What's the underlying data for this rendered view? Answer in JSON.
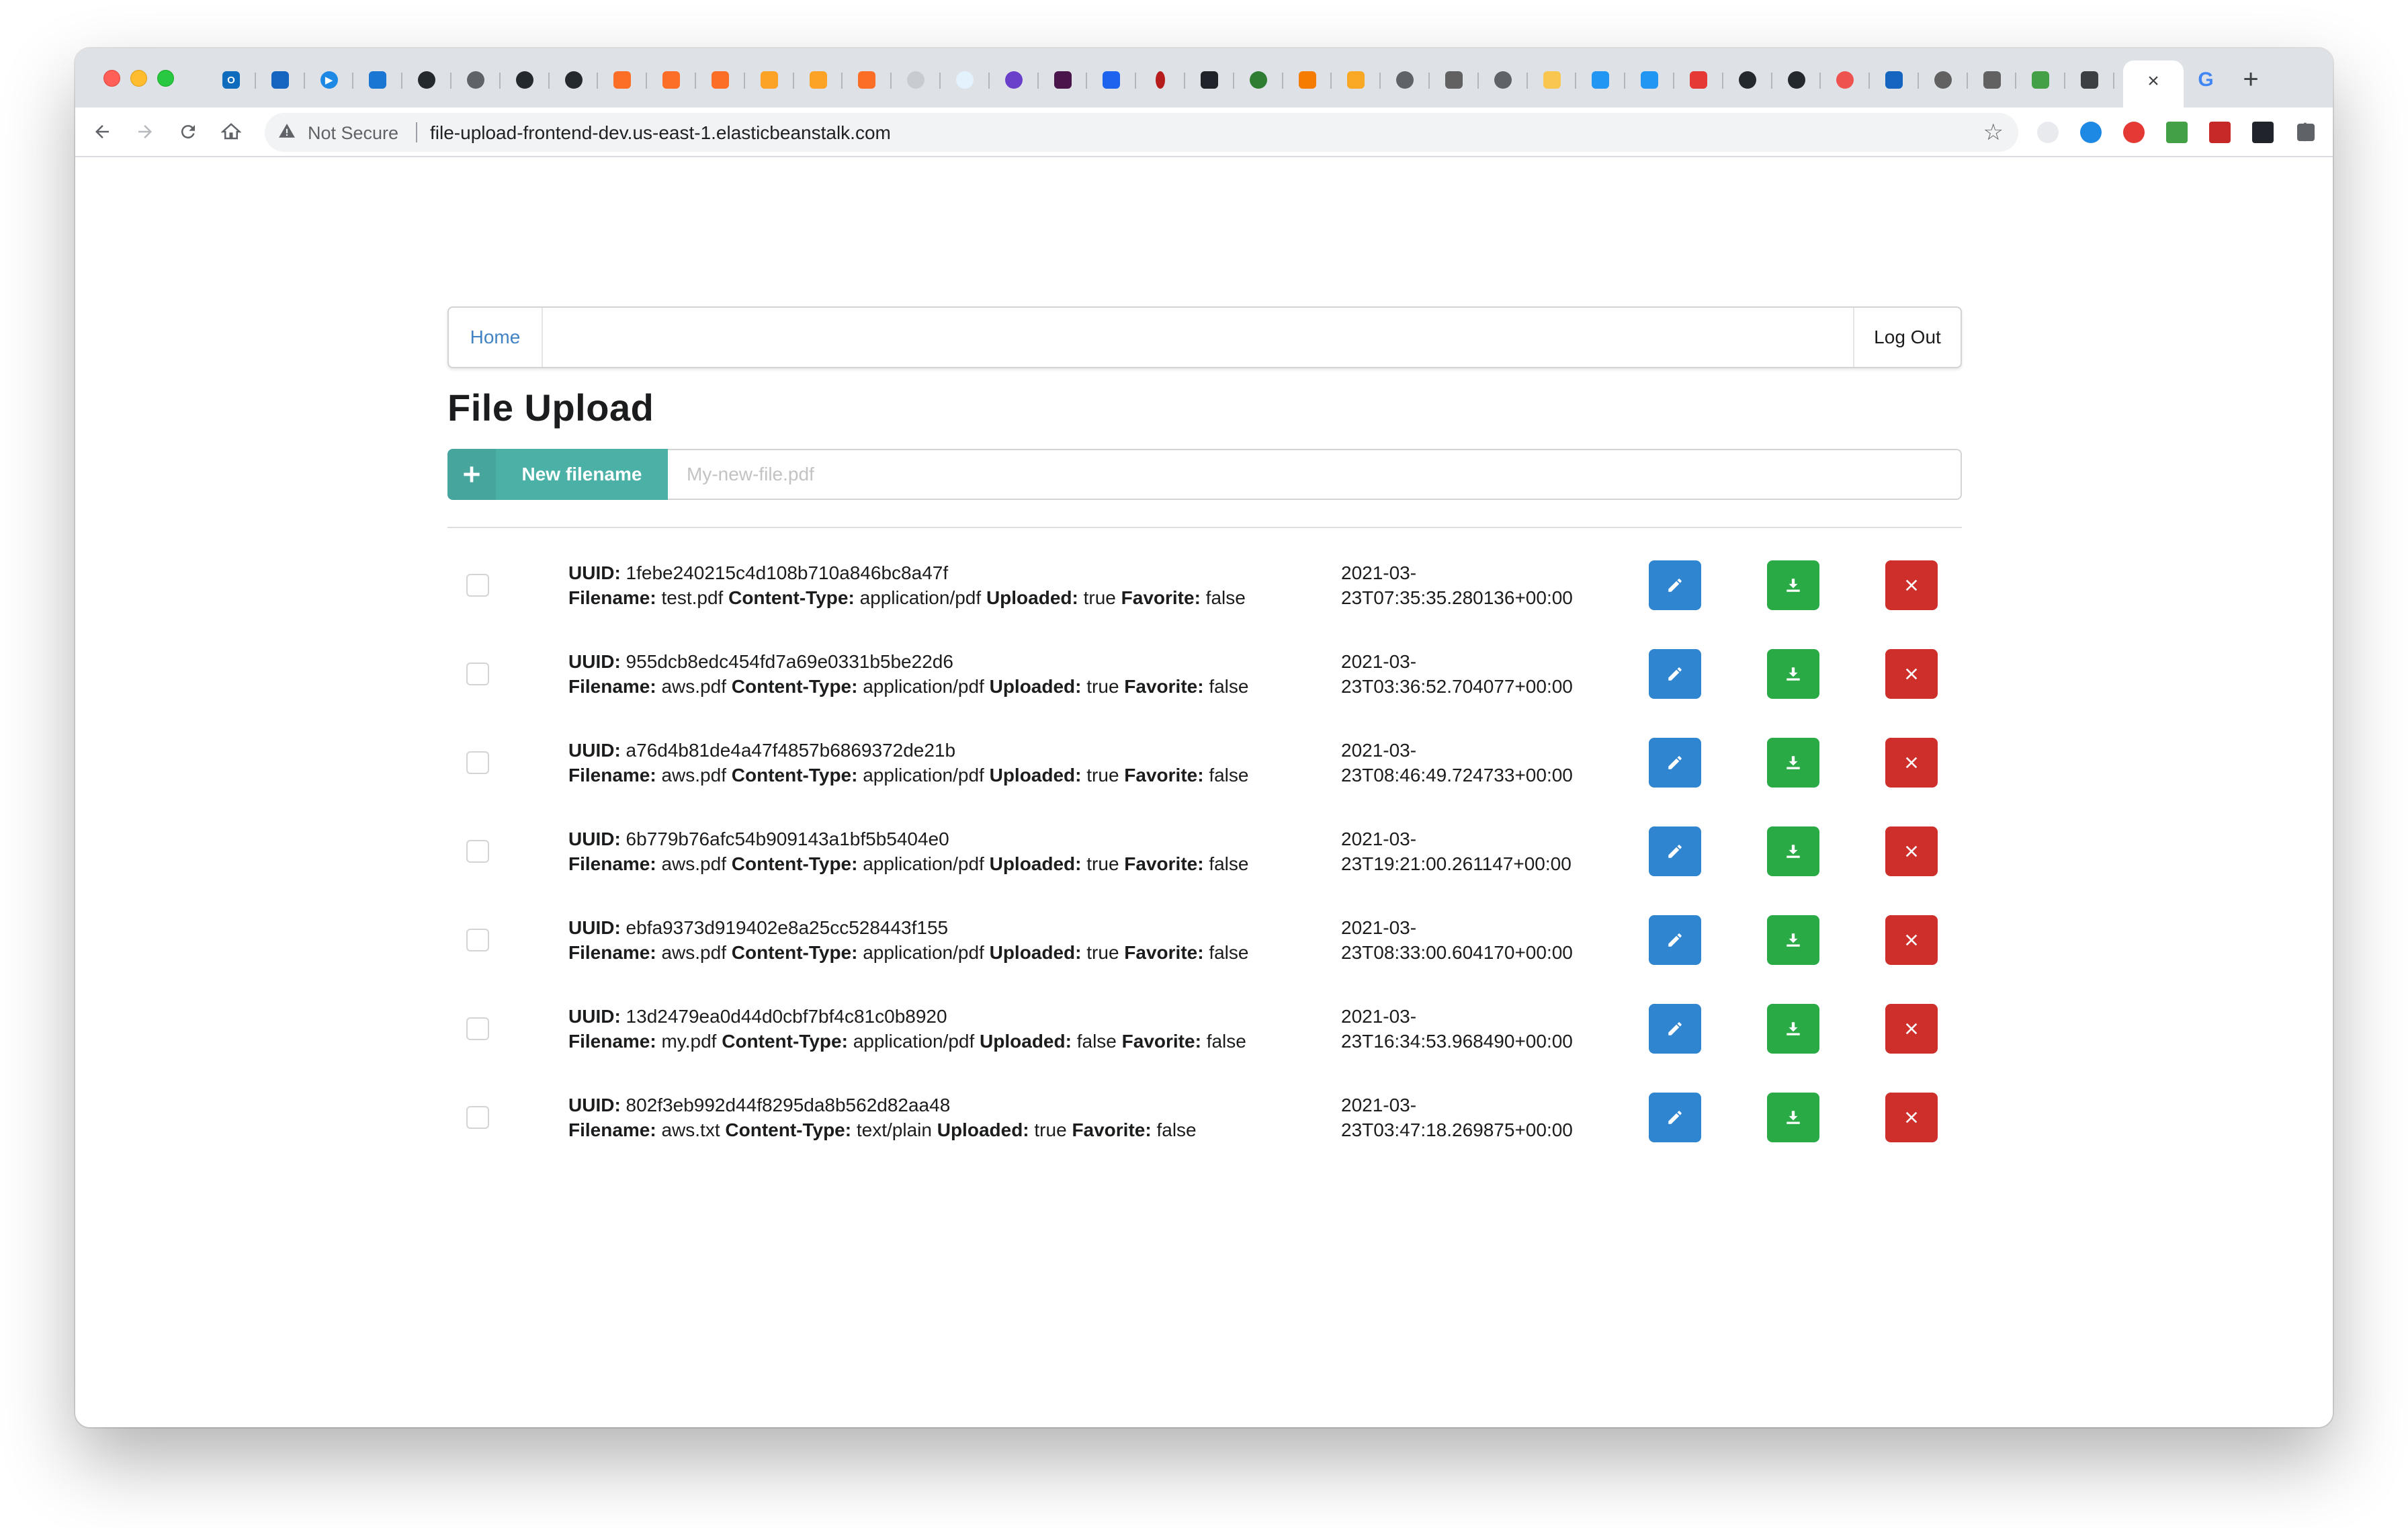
{
  "browser": {
    "tab_close_glyph": "×",
    "google_glyph": "G",
    "newtab_glyph": "+",
    "security_label": "Not Secure",
    "url": "file-upload-frontend-dev.us-east-1.elasticbeanstalk.com"
  },
  "nav": {
    "home_label": "Home",
    "logout_label": "Log Out"
  },
  "page": {
    "title": "File Upload"
  },
  "upload": {
    "button_label": "New filename",
    "placeholder": "My-new-file.pdf"
  },
  "labels": {
    "uuid": "UUID:",
    "filename": "Filename:",
    "content_type": "Content-Type:",
    "uploaded": "Uploaded:",
    "favorite": "Favorite:"
  },
  "files": [
    {
      "uuid": "1febe240215c4d108b710a846bc8a47f",
      "filename": "test.pdf",
      "content_type": "application/pdf",
      "uploaded": "true",
      "favorite": "false",
      "date": "2021-03-\n23T07:35:35.280136+00:00"
    },
    {
      "uuid": "955dcb8edc454fd7a69e0331b5be22d6",
      "filename": "aws.pdf",
      "content_type": "application/pdf",
      "uploaded": "true",
      "favorite": "false",
      "date": "2021-03-\n23T03:36:52.704077+00:00"
    },
    {
      "uuid": "a76d4b81de4a47f4857b6869372de21b",
      "filename": "aws.pdf",
      "content_type": "application/pdf",
      "uploaded": "true",
      "favorite": "false",
      "date": "2021-03-\n23T08:46:49.724733+00:00"
    },
    {
      "uuid": "6b779b76afc54b909143a1bf5b5404e0",
      "filename": "aws.pdf",
      "content_type": "application/pdf",
      "uploaded": "true",
      "favorite": "false",
      "date": "2021-03-\n23T19:21:00.261147+00:00"
    },
    {
      "uuid": "ebfa9373d919402e8a25cc528443f155",
      "filename": "aws.pdf",
      "content_type": "application/pdf",
      "uploaded": "true",
      "favorite": "false",
      "date": "2021-03-\n23T08:33:00.604170+00:00"
    },
    {
      "uuid": "13d2479ea0d44d0cbf7bf4c81c0b8920",
      "filename": "my.pdf",
      "content_type": "application/pdf",
      "uploaded": "false",
      "favorite": "false",
      "date": "2021-03-\n23T16:34:53.968490+00:00"
    },
    {
      "uuid": "802f3eb992d44f8295da8b562d82aa48",
      "filename": "aws.txt",
      "content_type": "text/plain",
      "uploaded": "true",
      "favorite": "false",
      "date": "2021-03-\n23T03:47:18.269875+00:00"
    }
  ],
  "colors": {
    "add_button": "#4bb0a6",
    "edit_button": "#2f85d0",
    "download_button": "#29aa45",
    "delete_button": "#cf2f2b",
    "link": "#4183c4"
  },
  "icons": {
    "edit": "pencil-icon",
    "download": "download-icon",
    "delete": "close-icon",
    "add": "plus-icon"
  }
}
